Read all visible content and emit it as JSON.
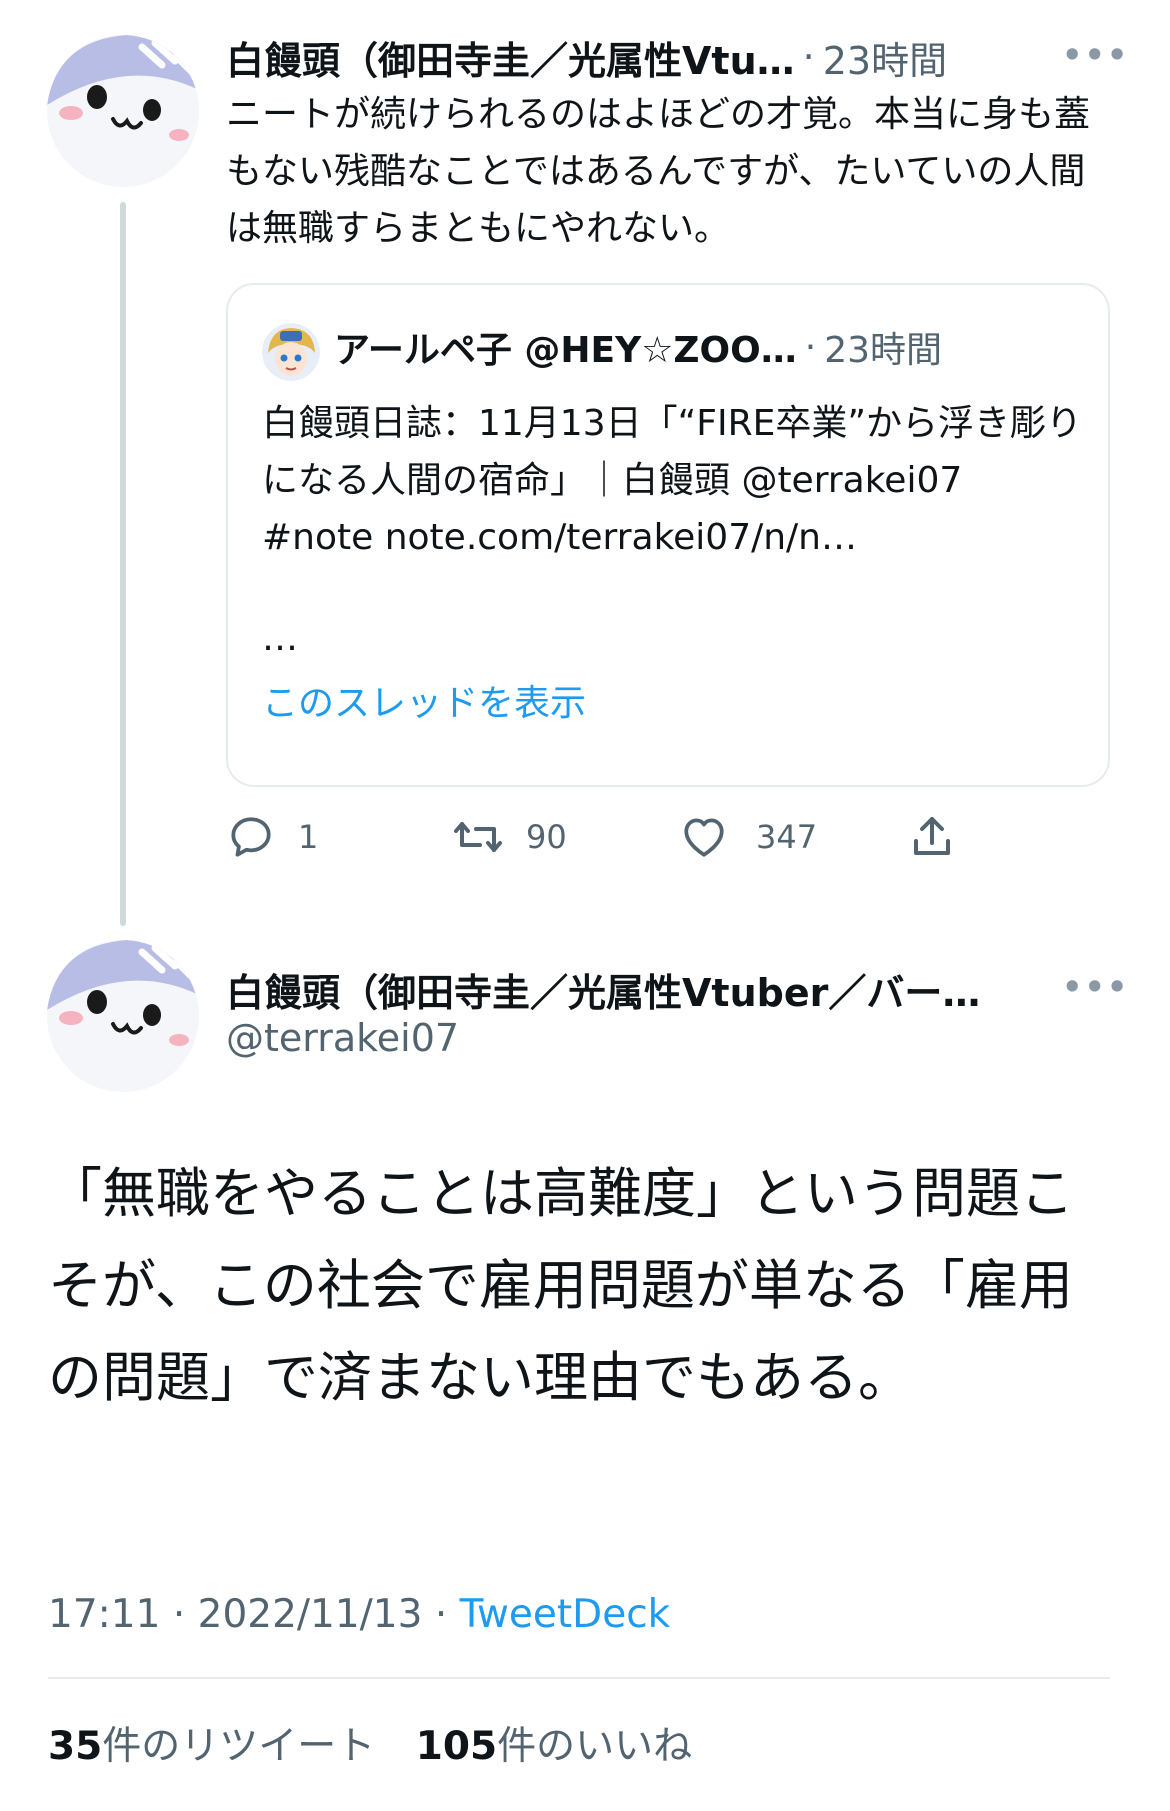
{
  "reply_tweet": {
    "author_name": "白饅頭（御田寺圭／光属性Vtu…",
    "separator": "·",
    "time": "23時間",
    "more_label": "•••",
    "text": "ニートが続けられるのはよほどの才覚。本当に身も蓋もない残酷なことではあるんですが、たいていの人間は無職すらまともにやれない。",
    "quote": {
      "author_name": "アールペ子 @HEY☆ZOO…",
      "separator": "·",
      "time": "23時間",
      "text": "白饅頭日誌：11月13日「“FIRE卒業”から浮き彫りになる人間の宿命」｜白饅頭 @terrakei07 #note note.com/terrakei07/n/n…",
      "ellipsis": "…",
      "show_thread": "このスレッドを表示"
    },
    "actions": {
      "reply_count": "1",
      "retweet_count": "90",
      "like_count": "347"
    }
  },
  "main_tweet": {
    "author_name": "白饅頭（御田寺圭／光属性Vtuber／バー…",
    "handle": "@terrakei07",
    "more_label": "•••",
    "text": "「無職をやることは高難度」という問題こそが、この社会で雇用問題が単なる「雇用の問題」で済まない理由でもある。",
    "time": "17:11",
    "sep1": "·",
    "date": "2022/11/13",
    "sep2": "·",
    "source": "TweetDeck",
    "retweet_count": "35",
    "retweet_label": "件のリツイート",
    "like_count": "105",
    "like_label": "件のいいね"
  },
  "colors": {
    "link": "#1d9bf0",
    "muted": "#536471",
    "avatar_band": "#b8bde6",
    "avatar_stripe": "#ffffff",
    "cheek": "#f5b3c0"
  },
  "icons": [
    "reply-icon",
    "retweet-icon",
    "like-icon",
    "share-icon",
    "more-icon",
    "avatar-face"
  ]
}
